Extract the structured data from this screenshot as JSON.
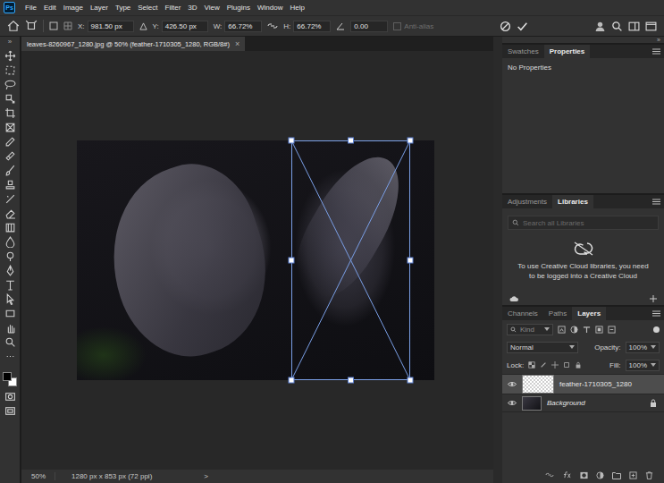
{
  "app": {
    "logo": "Ps"
  },
  "menu": [
    "File",
    "Edit",
    "Image",
    "Layer",
    "Type",
    "Select",
    "Filter",
    "3D",
    "View",
    "Plugins",
    "Window",
    "Help"
  ],
  "options_bar": {
    "x_label": "X:",
    "x": "981.50 px",
    "y_label": "Y:",
    "y": "426.50 px",
    "w_label": "W:",
    "w": "66.72%",
    "h_label": "H:",
    "h": "66.72%",
    "angle": "0.00",
    "anti_alias": {
      "label": "Anti-alias",
      "disabled": true
    }
  },
  "collapse": {
    "left": "»",
    "right": "»"
  },
  "document_tab": {
    "title": "leaves-8260967_1280.jpg @ 50% (feather-1710305_1280, RGB/8#)",
    "close": "×",
    "selected": true
  },
  "status_bar": {
    "zoom": "50%",
    "info": "1280 px x 853 px (72 ppi)",
    "arrow": ">"
  },
  "properties_panel": {
    "tabs": [
      {
        "label": "Swatches",
        "selected": false
      },
      {
        "label": "Properties",
        "selected": true
      }
    ],
    "body": "No Properties"
  },
  "libraries_panel": {
    "tabs": [
      {
        "label": "Adjustments",
        "selected": false
      },
      {
        "label": "Libraries",
        "selected": true
      }
    ],
    "search": {
      "placeholder": "Search all Libraries"
    },
    "message": "To use Creative Cloud libraries, you need to be logged into a Creative Cloud"
  },
  "layers_panel": {
    "tabs": [
      {
        "label": "Channels",
        "selected": false
      },
      {
        "label": "Paths",
        "selected": false
      },
      {
        "label": "Layers",
        "selected": true
      }
    ],
    "filter": "Kind",
    "blend_mode": "Normal",
    "opacity_label": "Opacity:",
    "opacity": "100%",
    "lock_label": "Lock:",
    "fill_label": "Fill:",
    "fill": "100%",
    "layers": [
      {
        "name": "feather-1710305_1280",
        "kind": "layer",
        "selected": true,
        "visible": true,
        "locked": false
      },
      {
        "name": "Background",
        "kind": "background",
        "selected": false,
        "visible": true,
        "locked": true
      }
    ]
  }
}
